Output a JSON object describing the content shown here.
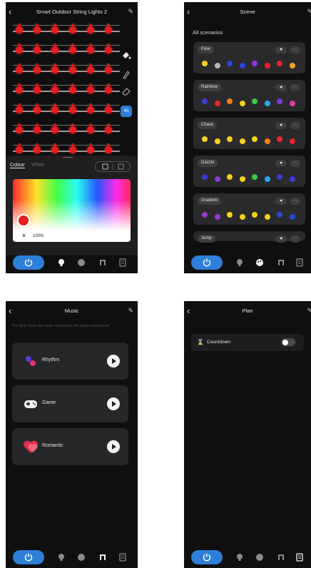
{
  "device": {
    "title": "Smart Outdoor String Lights 2",
    "tabs": [
      "Colour",
      "White"
    ],
    "brightness_label": "100%",
    "seg_button_label": "45",
    "strand_count": 7,
    "bulbs_per_strand": 6,
    "bulb_color": "#e81d1d"
  },
  "scene": {
    "title": "Scene",
    "section_label": "All scenarios",
    "scenes": [
      {
        "name": "Flow",
        "colors": [
          "#f4d21c",
          "#b9b9b9",
          "#2747d6",
          "#2747d6",
          "#8c3ad0",
          "#e8272b",
          "#e8272b",
          "#f4a21c"
        ]
      },
      {
        "name": "Rainbow",
        "colors": [
          "#3d3bd1",
          "#e8272b",
          "#f07f1c",
          "#f4d21c",
          "#3bc84a",
          "#2aa7e8",
          "#7a39d4",
          "#d93aa6"
        ]
      },
      {
        "name": "Chase",
        "colors": [
          "#f4d21c",
          "#f4d21c",
          "#f4d21c",
          "#f4d21c",
          "#f4d21c",
          "#f07f1c",
          "#e8272b",
          "#e8272b"
        ]
      },
      {
        "name": "Dazzle",
        "colors": [
          "#3d3bd1",
          "#8c3ad0",
          "#f4d21c",
          "#f4d21c",
          "#3bc84a",
          "#2aa7e8",
          "#3d3bd1",
          "#3d3bd1"
        ]
      },
      {
        "name": "Gradient",
        "colors": [
          "#9a3ad0",
          "#9a3ad0",
          "#f4d21c",
          "#f4d21c",
          "#f4d21c",
          "#f4d21c",
          "#2747d6",
          "#2747d6"
        ]
      },
      {
        "name": "Jump",
        "colors": []
      }
    ]
  },
  "music": {
    "title": "Music",
    "description": "The lights follow the music collected by the phone microphone",
    "modes": [
      {
        "label": "Rhythm",
        "icon": "rhythm-icon"
      },
      {
        "label": "Game",
        "icon": "gamepad-icon"
      },
      {
        "label": "Romantic",
        "icon": "heart-icon"
      }
    ]
  },
  "plan": {
    "title": "Plan",
    "countdown_label": "Countdown",
    "countdown_enabled": false
  },
  "nav": {
    "items": [
      "power-icon",
      "bulb-icon",
      "palette-icon",
      "music-icon",
      "schedule-icon"
    ],
    "active": {
      "device": "power-icon",
      "scene": "palette-icon",
      "music": "music-icon",
      "plan": "schedule-icon"
    }
  },
  "colors": {
    "accent": "#2d7fd8",
    "background": "#0f0f10",
    "card": "#2a2a2c"
  }
}
